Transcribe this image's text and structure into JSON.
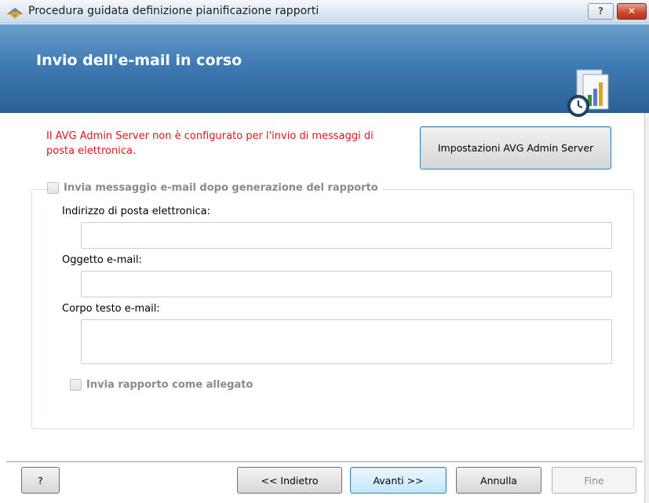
{
  "window": {
    "title": "Procedura guidata definizione pianificazione rapporti",
    "help_label": "?",
    "close_label": "✕"
  },
  "banner": {
    "title": "Invio dell'e-mail in corso",
    "icon": "report-schedule-icon"
  },
  "warning": {
    "text": "Il AVG Admin Server non è configurato per l'invio di messaggi di posta elettronica.",
    "color": "#e4141b"
  },
  "avg_settings_button": "Impostazioni AVG Admin Server",
  "email_group": {
    "checkbox_label": "Invia messaggio e-mail dopo generazione del rapporto",
    "checked": false,
    "address_label": "Indirizzo di posta elettronica:",
    "address_value": "",
    "subject_label": "Oggetto e-mail:",
    "subject_value": "",
    "body_label": "Corpo testo e-mail:",
    "body_value": "",
    "attach_label": "Invia rapporto come allegato",
    "attach_checked": false
  },
  "footer": {
    "help": "?",
    "back": "<< Indietro",
    "next": "Avanti >>",
    "cancel": "Annulla",
    "finish": "Fine"
  },
  "colors": {
    "banner": "#3f7bb4",
    "accent": "#3c7fb1"
  }
}
